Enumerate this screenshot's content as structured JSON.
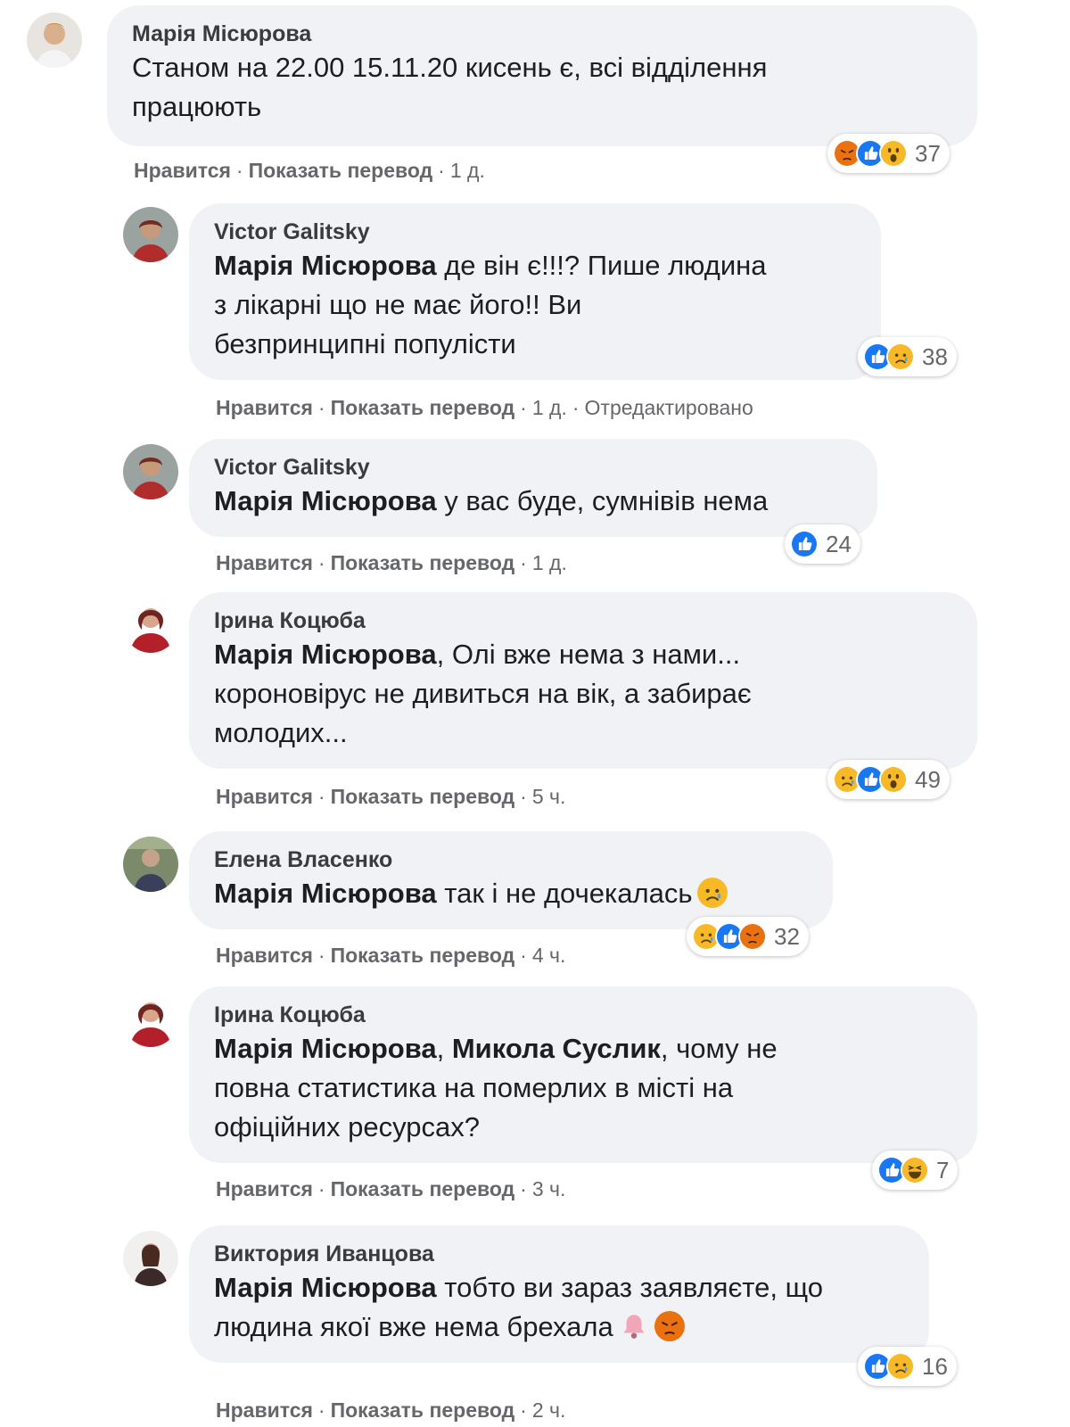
{
  "actions": {
    "like": "Нравится",
    "translate": "Показать перевод",
    "separator": "·"
  },
  "comments": [
    {
      "author": "Марія Місюрова",
      "lines": [
        "Станом на 22.00 15.11.20 кисень є, всі відділення",
        "працюють"
      ],
      "reactions": [
        "angry-icon",
        "like-icon",
        "wow-icon"
      ],
      "reaction_count": "37",
      "time": "1 д.",
      "edited": ""
    },
    {
      "author": "Victor Galitsky",
      "mention": "Марія Місюрова",
      "lines": [
        " де він є!!!? Пише людина",
        "з лікарні що не має його!! Ви",
        "безпринципні популісти"
      ],
      "reactions": [
        "like-icon",
        "sad-icon"
      ],
      "reaction_count": "38",
      "time": "1 д.",
      "edited": "Отредактировано"
    },
    {
      "author": "Victor Galitsky",
      "mention": "Марія Місюрова",
      "lines": [
        " у вас буде, сумнівів нема"
      ],
      "reactions": [
        "like-icon"
      ],
      "reaction_count": "24",
      "time": "1 д.",
      "edited": ""
    },
    {
      "author": "Ірина Коцюба",
      "mention": "Марія Місюрова",
      "lines": [
        ", Олі вже нема з нами...",
        "короновірус не дивиться на вік, а забирає",
        "молодих..."
      ],
      "reactions": [
        "sad-icon",
        "like-icon",
        "wow-icon"
      ],
      "reaction_count": "49",
      "time": "5 ч.",
      "edited": ""
    },
    {
      "author": "Елена Власенко",
      "mention": "Марія Місюрова",
      "lines": [
        " так і не дочекалась"
      ],
      "reactions": [
        "sad-icon",
        "like-icon",
        "angry-icon"
      ],
      "reaction_count": "32",
      "time": "4 ч.",
      "edited": ""
    },
    {
      "author": "Ірина Коцюба",
      "mention": "Марія Місюрова",
      "mention2": "Микола Суслик",
      "lines": [
        ", ",
        ", чому не",
        "повна статистика на померлих в місті на",
        "офіційних ресурсах?"
      ],
      "reactions": [
        "like-icon",
        "haha-icon"
      ],
      "reaction_count": "7",
      "time": "3 ч.",
      "edited": ""
    },
    {
      "author": "Виктория Иванцова",
      "mention": "Марія Місюрова",
      "lines": [
        " тобто ви зараз заявляєте, що",
        "людина якої вже нема брехала"
      ],
      "reactions": [
        "like-icon",
        "sad-icon"
      ],
      "reaction_count": "16",
      "time": "2 ч.",
      "edited": ""
    }
  ],
  "colors": {
    "like": "#1877f2",
    "yellow": "#f7b928",
    "angry": "#e9710f",
    "bubble": "#f0f2f5"
  }
}
